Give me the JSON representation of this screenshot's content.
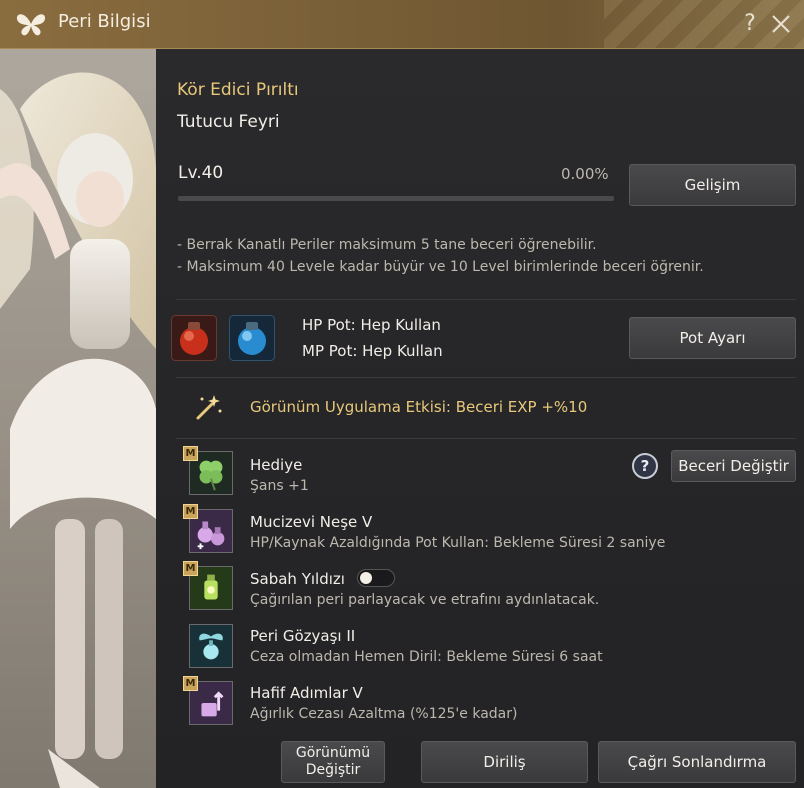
{
  "window": {
    "title": "Peri Bilgisi"
  },
  "header": {
    "name": "Kör Edici Pırıltı",
    "subtitle": "Tutucu Feyri",
    "level": "Lv.40",
    "exp_percent": "0.00%",
    "exp_fraction": 0.0,
    "upgrade_button": "Gelişim"
  },
  "info_lines": [
    "- Berrak Kanatlı Periler maksimum 5 tane beceri öğrenebilir.",
    "- Maksimum 40 Levele kadar büyür ve 10 Level birimlerinde beceri öğrenir."
  ],
  "potions": {
    "hp": "HP Pot: Hep Kullan",
    "mp": "MP Pot: Hep Kullan",
    "button": "Pot Ayarı"
  },
  "appearance_effect": "Görünüm Uygulama Etkisi: Beceri EXP +%10",
  "skills_panel": {
    "change_skill_button": "Beceri Değiştir",
    "help_label": "?"
  },
  "skills": [
    {
      "badge": "M",
      "name": "Hediye",
      "desc": "Şans +1",
      "icon": "clover-icon"
    },
    {
      "badge": "M",
      "name": "Mucizevi Neşe V",
      "desc": "HP/Kaynak Azaldığında Pot Kullan: Bekleme Süresi 2 saniye",
      "icon": "potion-flasks-icon"
    },
    {
      "badge": "M",
      "name": "Sabah Yıldızı",
      "desc": "Çağırılan peri parlayacak ve etrafını aydınlatacak.",
      "icon": "lantern-icon",
      "toggle": "off"
    },
    {
      "badge": "",
      "name": "Peri Gözyaşı II",
      "desc": "Ceza olmadan Hemen Diril: Bekleme Süresi 6 saat",
      "icon": "winged-vial-icon"
    },
    {
      "badge": "M",
      "name": "Hafif Adımlar V",
      "desc": "Ağırlık Cezası Azaltma (%125'e kadar)",
      "icon": "weight-arrow-icon"
    }
  ],
  "footer": {
    "appearance_button_line1": "Görünümü",
    "appearance_button_line2": "Değiştir",
    "revive_button": "Diriliş",
    "end_summon_button": "Çağrı Sonlandırma"
  },
  "colors": {
    "gold": "#e8c87a",
    "titlebar": "#7a6038",
    "panel": "#262628"
  }
}
